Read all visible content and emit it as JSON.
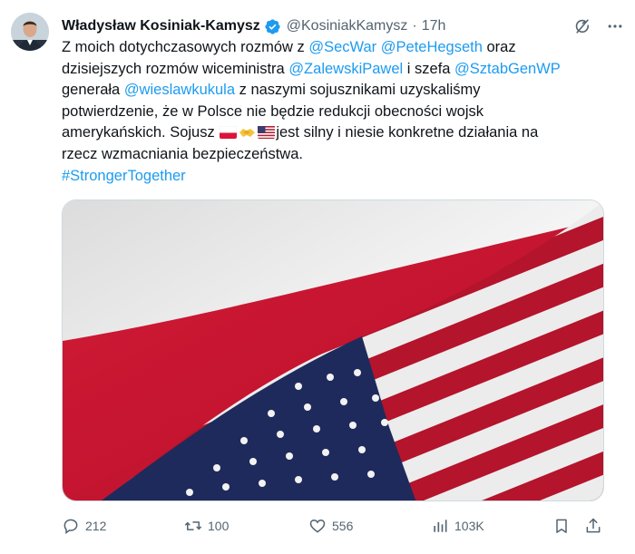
{
  "author": {
    "name": "Władysław Kosiniak-Kamysz",
    "handle": "@KosiniakKamysz",
    "separator": "·",
    "time": "17h"
  },
  "text": {
    "l1_a": "Z moich dotychczasowych rozmów z ",
    "m_secwar": "@SecWar",
    "m_hegseth": "@PeteHegseth",
    "l1_b": " oraz",
    "l2_a": "dzisiejszych rozmów wiceministra ",
    "m_zalewski": "@ZalewskiPawel",
    "l2_b": " i szefa ",
    "m_sztab": "@SztabGenWP",
    "l3_a": "generała ",
    "m_kukula": "@wieslawkukula",
    "l3_b": " z naszymi sojusznikami uzyskaliśmy",
    "l4": "potwierdzenie, że w Polsce nie będzie redukcji obecności wojsk",
    "l5_a": "amerykańskich. Sojusz ",
    "l5_b": "jest silny i niesie konkretne działania na",
    "l6": "rzecz wzmacniania bezpieczeństwa.",
    "hashtag": "#StrongerTogether"
  },
  "icons": {
    "verified": "verified-badge-icon",
    "grok": "grok-icon",
    "more": "more-options-icon",
    "poland_flag": "poland-flag-emoji",
    "handshake": "handshake-emoji",
    "us_flag": "us-flag-emoji"
  },
  "colors": {
    "accent": "#1d9bf0",
    "secondary_text": "#536471",
    "poland_red": "#dc143c",
    "us_red": "#b22234",
    "us_blue": "#3c3b6e"
  },
  "stats": {
    "replies": "212",
    "reposts": "100",
    "likes": "556",
    "views": "103K"
  }
}
